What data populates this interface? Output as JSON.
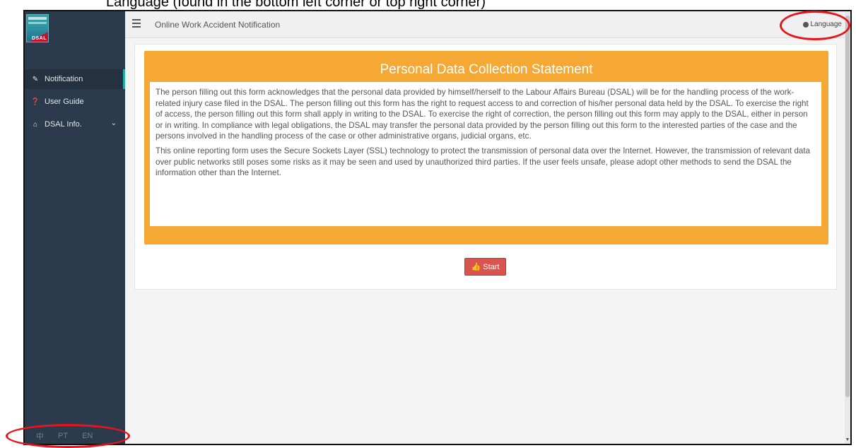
{
  "caption": "Language (found in the bottom left corner or top right corner)",
  "sidebar": {
    "logo_text": "DSAL",
    "items": [
      {
        "label": "Notification",
        "icon": "edit-icon"
      },
      {
        "label": "User Guide",
        "icon": "question-circle-icon"
      },
      {
        "label": "DSAL Info.",
        "icon": "home-icon"
      }
    ],
    "languages": [
      "中",
      "PT",
      "EN"
    ]
  },
  "topbar": {
    "title": "Online Work Accident Notification",
    "language_label": "Language"
  },
  "statement": {
    "title": "Personal Data Collection Statement",
    "paragraphs": [
      "The person filling out this form acknowledges that the personal data provided by himself/herself to the Labour Affairs Bureau (DSAL) will be for the handling process of the work-related injury case filed in the DSAL. The person filling out this form has the right to request access to and correction of his/her personal data held by the DSAL. To exercise the right of access, the person filling out this form shall apply in writing to the DSAL. To exercise the right of correction, the person filling out this form may apply to the DSAL, either in person or in writing. In compliance with legal obligations, the DSAL may transfer the personal data provided by the person filling out this form to the interested parties of the case and the persons involved in the handling process of the case or other administrative organs, judicial organs, etc.",
      "This online reporting form uses the Secure Sockets Layer (SSL) technology to protect the transmission of personal data over the Internet. However, the transmission of relevant data over public networks still poses some risks as it may be seen and used by unauthorized third parties. If the user feels unsafe, please adopt other methods to send the DSAL the information other than the Internet."
    ]
  },
  "start_button": {
    "label": "Start",
    "icon": "thumbs-up-icon"
  },
  "colors": {
    "sidebar": "#2b3a4c",
    "accent_orange": "#f5a833",
    "start_red": "#d9534f",
    "highlight_ellipse": "#e8141b"
  }
}
